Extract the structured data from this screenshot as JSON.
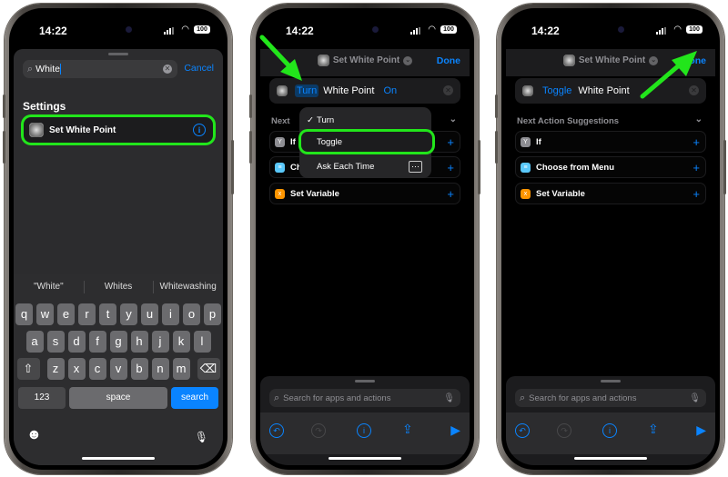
{
  "status_bar": {
    "time": "14:22",
    "battery": "100"
  },
  "screen1": {
    "search": {
      "value": "White",
      "clear_icon": "clear-icon",
      "cancel_label": "Cancel"
    },
    "section_header": "Settings",
    "result": {
      "label": "Set White Point",
      "icon": "settings-gear-icon",
      "info_icon": "info-icon"
    },
    "keyboard": {
      "suggestions": [
        "\"White\"",
        "Whites",
        "Whitewashing"
      ],
      "row1": [
        "q",
        "w",
        "e",
        "r",
        "t",
        "y",
        "u",
        "i",
        "o",
        "p"
      ],
      "row2": [
        "a",
        "s",
        "d",
        "f",
        "g",
        "h",
        "j",
        "k",
        "l"
      ],
      "row3": [
        "z",
        "x",
        "c",
        "v",
        "b",
        "n",
        "m"
      ],
      "shift": "⇧",
      "delete": "⌫",
      "numbers_label": "123",
      "space_label": "space",
      "search_label": "search",
      "emoji": "☻",
      "mic": "🎙"
    }
  },
  "screen2": {
    "header": {
      "title": "Set White Point",
      "done_label": "Done"
    },
    "action": {
      "verb": "Turn",
      "object": "White Point",
      "state": "On"
    },
    "next_label": "Next",
    "menu": {
      "items": [
        {
          "label": "Turn",
          "checked": true
        },
        {
          "label": "Toggle",
          "checked": false,
          "highlighted": true
        },
        {
          "label": "Ask Each Time",
          "checked": false
        }
      ]
    },
    "suggestions": [
      {
        "label": "If",
        "icon": "if-icon",
        "color": "#8e8e93"
      },
      {
        "label": "Choose from Menu",
        "icon": "menu-icon",
        "color": "#5ac8fa"
      },
      {
        "label": "Set Variable",
        "icon": "variable-icon",
        "color": "#ff9500"
      }
    ],
    "bottom": {
      "search_placeholder": "Search for apps and actions"
    }
  },
  "screen3": {
    "header": {
      "title": "Set White Point",
      "done_label": "Done"
    },
    "action": {
      "verb": "Toggle",
      "object": "White Point"
    },
    "section_label": "Next Action Suggestions",
    "suggestions": [
      {
        "label": "If",
        "icon": "if-icon",
        "color": "#8e8e93"
      },
      {
        "label": "Choose from Menu",
        "icon": "menu-icon",
        "color": "#5ac8fa"
      },
      {
        "label": "Set Variable",
        "icon": "variable-icon",
        "color": "#ff9500"
      }
    ],
    "bottom": {
      "search_placeholder": "Search for apps and actions"
    }
  },
  "colors": {
    "accent": "#0a84ff",
    "highlight": "#22e51b",
    "background": "#000000",
    "sheet": "#2c2c2e"
  }
}
